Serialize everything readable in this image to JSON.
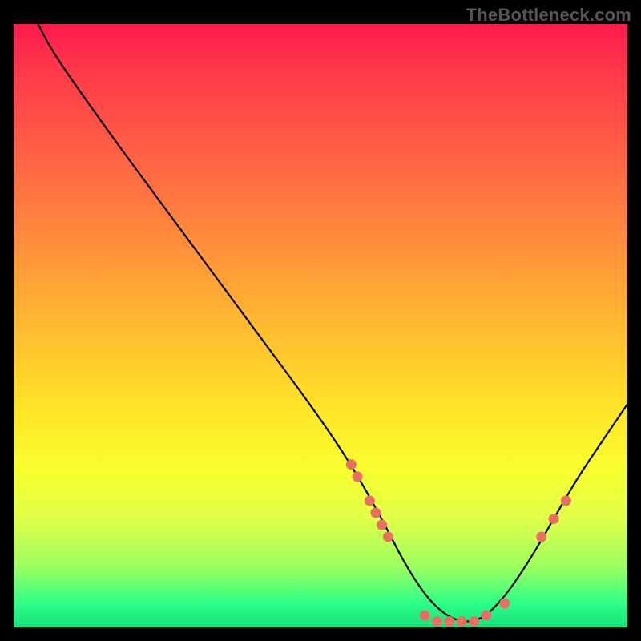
{
  "attribution": "TheBottleneck.com",
  "colors": {
    "page_bg": "#000000",
    "attribution_text": "#555555",
    "curve_stroke": "#000000",
    "marker_fill": "#e87062",
    "gradient_stops": [
      "#ff1a4d",
      "#ff3a4a",
      "#ff5746",
      "#ff7a3f",
      "#ff9a38",
      "#ffc02f",
      "#ffe526",
      "#f8ff2e",
      "#e0ff4a",
      "#9cff60",
      "#2dff88",
      "#18e07a"
    ]
  },
  "chart_data": {
    "type": "line",
    "title": "",
    "xlabel": "",
    "ylabel": "",
    "xlim": [
      0,
      100
    ],
    "ylim": [
      0,
      100
    ],
    "grid": false,
    "series": [
      {
        "name": "bottleneck-curve",
        "x": [
          4,
          6,
          10,
          17,
          25,
          33,
          41,
          49,
          55,
          60,
          64,
          68,
          72,
          76,
          80,
          84,
          88,
          92,
          96,
          100
        ],
        "values": [
          100,
          96,
          90,
          80,
          69,
          58,
          47,
          36,
          27,
          18,
          10,
          4,
          1,
          1,
          5,
          11,
          18,
          25,
          31,
          37
        ]
      }
    ],
    "markers": [
      {
        "name": "left-cluster-top-1",
        "x": 55,
        "y": 27
      },
      {
        "name": "left-cluster-top-2",
        "x": 56,
        "y": 25
      },
      {
        "name": "left-cluster-mid-1",
        "x": 58,
        "y": 21
      },
      {
        "name": "left-cluster-mid-2",
        "x": 59,
        "y": 19
      },
      {
        "name": "left-cluster-mid-3",
        "x": 60,
        "y": 17
      },
      {
        "name": "left-cluster-low",
        "x": 61,
        "y": 15
      },
      {
        "name": "min-cluster-1",
        "x": 67,
        "y": 2
      },
      {
        "name": "min-cluster-2",
        "x": 69,
        "y": 1
      },
      {
        "name": "min-cluster-3",
        "x": 71,
        "y": 1
      },
      {
        "name": "min-cluster-4",
        "x": 73,
        "y": 1
      },
      {
        "name": "min-cluster-5",
        "x": 75,
        "y": 1
      },
      {
        "name": "min-cluster-6",
        "x": 77,
        "y": 2
      },
      {
        "name": "min-cluster-7",
        "x": 80,
        "y": 4
      },
      {
        "name": "right-cluster-1",
        "x": 86,
        "y": 15
      },
      {
        "name": "right-cluster-2",
        "x": 88,
        "y": 18
      },
      {
        "name": "right-cluster-3",
        "x": 90,
        "y": 21
      }
    ]
  }
}
